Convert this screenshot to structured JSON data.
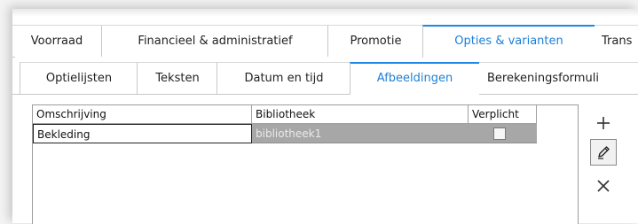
{
  "main_tabs": [
    {
      "label": "Voorraad"
    },
    {
      "label": "Financieel & administratief"
    },
    {
      "label": "Promotie"
    },
    {
      "label": "Opties & varianten"
    },
    {
      "label": "Trans"
    }
  ],
  "main_active_tab": "Opties & varianten",
  "sub_tabs": [
    {
      "label": "Optielijsten"
    },
    {
      "label": "Teksten"
    },
    {
      "label": "Datum en tijd"
    },
    {
      "label": "Afbeeldingen"
    },
    {
      "label": "Berekeningsformuli"
    }
  ],
  "sub_active_tab": "Afbeeldingen",
  "grid": {
    "columns": [
      "Omschrijving",
      "Bibliotheek",
      "Verplicht"
    ],
    "rows": [
      {
        "omschrijving": "Bekleding",
        "bibliotheek": "bibliotheek1",
        "verplicht": false
      }
    ]
  },
  "side_buttons": {
    "add_icon": "plus-icon",
    "edit_icon": "pencil-icon",
    "delete_icon": "close-icon"
  },
  "colors": {
    "accent": "#1e88e5",
    "active_tab_text": "#1e7fd6",
    "selected_row_fill": "#a7a7a7"
  }
}
